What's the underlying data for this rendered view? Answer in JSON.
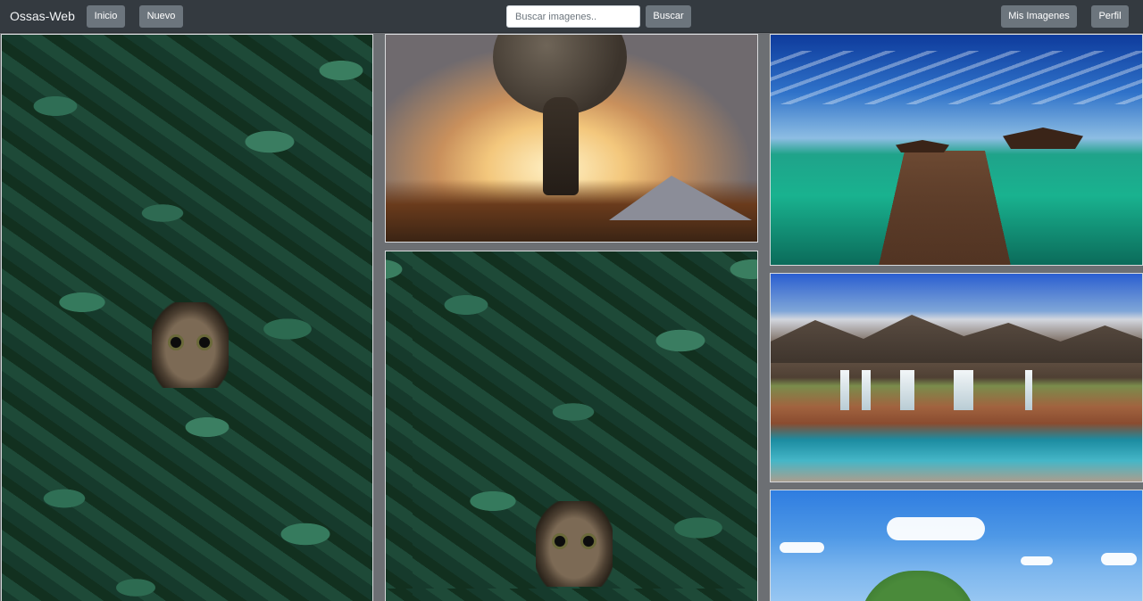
{
  "navbar": {
    "brand": "Ossas-Web",
    "inicio": "Inicio",
    "nuevo": "Nuevo",
    "search_placeholder": "Buscar imagenes..",
    "buscar": "Buscar",
    "mis_imagenes": "Mis Imagenes",
    "perfil": "Perfil"
  },
  "gallery": {
    "images": [
      "cat-in-leaves",
      "atlas-holding-globe",
      "cat-in-leaves",
      "tropical-pier",
      "mountain-waterfall",
      "green-island"
    ]
  },
  "colors": {
    "navbar_bg": "#343a40",
    "button_bg": "#6c757d",
    "page_bg": "#6c6f73"
  }
}
